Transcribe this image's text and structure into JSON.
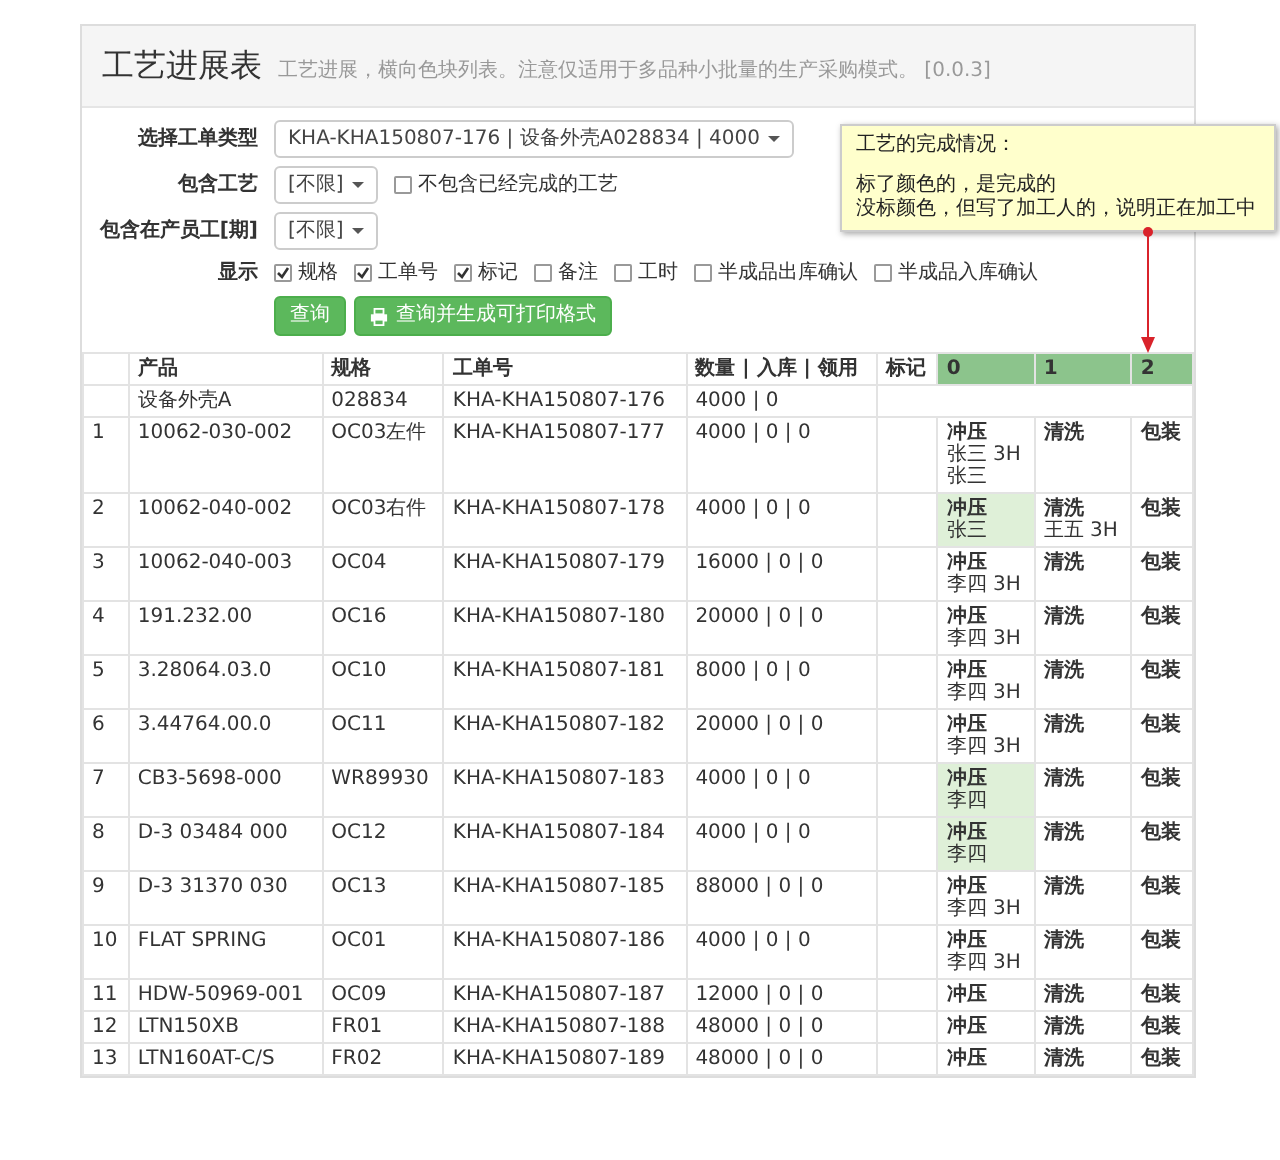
{
  "title": "工艺进展表",
  "subtitle": "工艺进展，横向色块列表。注意仅适用于多品种小批量的生产采购模式。 [0.0.3]",
  "form": {
    "order_type": {
      "label": "选择工单类型",
      "value": "KHA-KHA150807-176   |   设备外壳A028834   |   4000"
    },
    "process": {
      "label": "包含工艺",
      "value": "[不限]",
      "checkbox": {
        "label": "不包含已经完成的工艺",
        "checked": false
      }
    },
    "staff": {
      "label": "包含在产员工[期]",
      "value": "[不限]"
    },
    "display": {
      "label": "显示",
      "options": [
        {
          "label": "规格",
          "checked": true
        },
        {
          "label": "工单号",
          "checked": true
        },
        {
          "label": "标记",
          "checked": true
        },
        {
          "label": "备注",
          "checked": false
        },
        {
          "label": "工时",
          "checked": false
        },
        {
          "label": "半成品出库确认",
          "checked": false
        },
        {
          "label": "半成品入库确认",
          "checked": false
        }
      ]
    },
    "buttons": [
      {
        "label": "查询",
        "kind": "plain"
      },
      {
        "label": "查询并生成可打印格式",
        "kind": "print"
      }
    ]
  },
  "note": {
    "title": "工艺的完成情况：",
    "lines": [
      "标了颜色的，是完成的",
      "没标颜色，但写了加工人的，说明正在加工中"
    ]
  },
  "table": {
    "columns": [
      {
        "label": "产品",
        "highlighted": false
      },
      {
        "label": "规格",
        "highlighted": false
      },
      {
        "label": "工单号",
        "highlighted": false
      },
      {
        "label": "数量 | 入库 | 领用",
        "highlighted": false
      },
      {
        "label": "标记",
        "highlighted": false
      },
      {
        "label": "0",
        "highlighted": true
      },
      {
        "label": "1",
        "highlighted": true
      },
      {
        "label": "2",
        "highlighted": true
      }
    ],
    "summary": {
      "product": "设备外壳A",
      "spec": "028834",
      "order": "KHA-KHA150807-176",
      "qty": "4000 | 0"
    },
    "rows": [
      {
        "no": "1",
        "product": "10062-030-002",
        "spec": "OC03左件",
        "order": "KHA-KHA150807-177",
        "qty": "4000 | 0 | 0",
        "stages": [
          {
            "name": "冲压",
            "done": false,
            "workers": [
              "张三 3H",
              "张三"
            ]
          },
          {
            "name": "清洗",
            "done": false
          },
          {
            "name": "包装",
            "done": false
          }
        ]
      },
      {
        "no": "2",
        "product": "10062-040-002",
        "spec": "OC03右件",
        "order": "KHA-KHA150807-178",
        "qty": "4000 | 0 | 0",
        "stages": [
          {
            "name": "冲压",
            "done": true,
            "workers": [
              "张三"
            ]
          },
          {
            "name": "清洗",
            "done": false,
            "workers": [
              "王五 3H"
            ]
          },
          {
            "name": "包装",
            "done": false
          }
        ]
      },
      {
        "no": "3",
        "product": "10062-040-003",
        "spec": "OC04",
        "order": "KHA-KHA150807-179",
        "qty": "16000 | 0 | 0",
        "stages": [
          {
            "name": "冲压",
            "done": false,
            "workers": [
              "李四 3H"
            ]
          },
          {
            "name": "清洗",
            "done": false
          },
          {
            "name": "包装",
            "done": false
          }
        ]
      },
      {
        "no": "4",
        "product": "191.232.00",
        "spec": "OC16",
        "order": "KHA-KHA150807-180",
        "qty": "20000 | 0 | 0",
        "stages": [
          {
            "name": "冲压",
            "done": false,
            "workers": [
              "李四 3H"
            ]
          },
          {
            "name": "清洗",
            "done": false
          },
          {
            "name": "包装",
            "done": false
          }
        ]
      },
      {
        "no": "5",
        "product": "3.28064.03.0",
        "spec": "OC10",
        "order": "KHA-KHA150807-181",
        "qty": "8000 | 0 | 0",
        "stages": [
          {
            "name": "冲压",
            "done": false,
            "workers": [
              "李四 3H"
            ]
          },
          {
            "name": "清洗",
            "done": false
          },
          {
            "name": "包装",
            "done": false
          }
        ]
      },
      {
        "no": "6",
        "product": "3.44764.00.0",
        "spec": "OC11",
        "order": "KHA-KHA150807-182",
        "qty": "20000 | 0 | 0",
        "stages": [
          {
            "name": "冲压",
            "done": false,
            "workers": [
              "李四 3H"
            ]
          },
          {
            "name": "清洗",
            "done": false
          },
          {
            "name": "包装",
            "done": false
          }
        ]
      },
      {
        "no": "7",
        "product": "CB3-5698-000",
        "spec": "WR89930",
        "order": "KHA-KHA150807-183",
        "qty": "4000 | 0 | 0",
        "stages": [
          {
            "name": "冲压",
            "done": true,
            "workers": [
              "李四"
            ]
          },
          {
            "name": "清洗",
            "done": false
          },
          {
            "name": "包装",
            "done": false
          }
        ]
      },
      {
        "no": "8",
        "product": "D-3 03484 000",
        "spec": "OC12",
        "order": "KHA-KHA150807-184",
        "qty": "4000 | 0 | 0",
        "stages": [
          {
            "name": "冲压",
            "done": true,
            "workers": [
              "李四"
            ]
          },
          {
            "name": "清洗",
            "done": false
          },
          {
            "name": "包装",
            "done": false
          }
        ]
      },
      {
        "no": "9",
        "product": "D-3 31370 030",
        "spec": "OC13",
        "order": "KHA-KHA150807-185",
        "qty": "88000 | 0 | 0",
        "stages": [
          {
            "name": "冲压",
            "done": false,
            "workers": [
              "李四 3H"
            ]
          },
          {
            "name": "清洗",
            "done": false
          },
          {
            "name": "包装",
            "done": false
          }
        ]
      },
      {
        "no": "10",
        "product": "FLAT SPRING",
        "spec": "OC01",
        "order": "KHA-KHA150807-186",
        "qty": "4000 | 0 | 0",
        "stages": [
          {
            "name": "冲压",
            "done": false,
            "workers": [
              "李四 3H"
            ]
          },
          {
            "name": "清洗",
            "done": false
          },
          {
            "name": "包装",
            "done": false
          }
        ]
      },
      {
        "no": "11",
        "product": "HDW-50969-001",
        "spec": "OC09",
        "order": "KHA-KHA150807-187",
        "qty": "12000 | 0 | 0",
        "stages": [
          {
            "name": "冲压",
            "done": false
          },
          {
            "name": "清洗",
            "done": false
          },
          {
            "name": "包装",
            "done": false
          }
        ]
      },
      {
        "no": "12",
        "product": "LTN150XB",
        "spec": "FR01",
        "order": "KHA-KHA150807-188",
        "qty": "48000 | 0 | 0",
        "stages": [
          {
            "name": "冲压",
            "done": false
          },
          {
            "name": "清洗",
            "done": false
          },
          {
            "name": "包装",
            "done": false
          }
        ]
      },
      {
        "no": "13",
        "product": "LTN160AT-C/S",
        "spec": "FR02",
        "order": "KHA-KHA150807-189",
        "qty": "48000 | 0 | 0",
        "stages": [
          {
            "name": "冲压",
            "done": false
          },
          {
            "name": "清洗",
            "done": false
          },
          {
            "name": "包装",
            "done": false
          }
        ]
      }
    ]
  }
}
